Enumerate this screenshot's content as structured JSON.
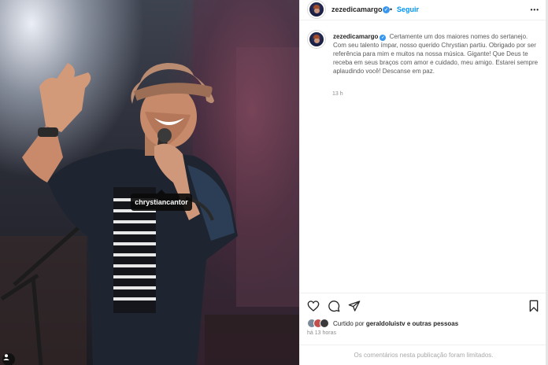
{
  "photo": {
    "tag_label": "chrystiancantor"
  },
  "post": {
    "username": "zezedicamargo",
    "follow_label": "Seguir",
    "separator": "•",
    "more_label": "•••",
    "caption": "Certamente um dos maiores nomes do sertanejo. Com seu talento ímpar, nosso querido Chrystian partiu. Obrigado por ser referência para mim e muitos na nossa música. Gigante! Que Deus te receba em seus braços com amor e cuidado, meu amigo. Estarei sempre aplaudindo você! Descanse em paz.",
    "caption_time": "13 h",
    "liked_prefix": "Curtido por",
    "liked_by": "geraldoluistv",
    "liked_suffix": "e outras pessoas",
    "time_ago": "há 13 horas",
    "comments_limited": "Os comentários nesta publicação foram limitados."
  },
  "icons": {
    "like": "heart-icon",
    "comment": "comment-icon",
    "share": "send-icon",
    "save": "bookmark-icon",
    "verified": "verified-badge-icon",
    "tagged": "user-icon"
  },
  "colors": {
    "link_blue": "#0095f6",
    "verified_blue": "#3797f0",
    "meta_gray": "#8e8e8e"
  }
}
